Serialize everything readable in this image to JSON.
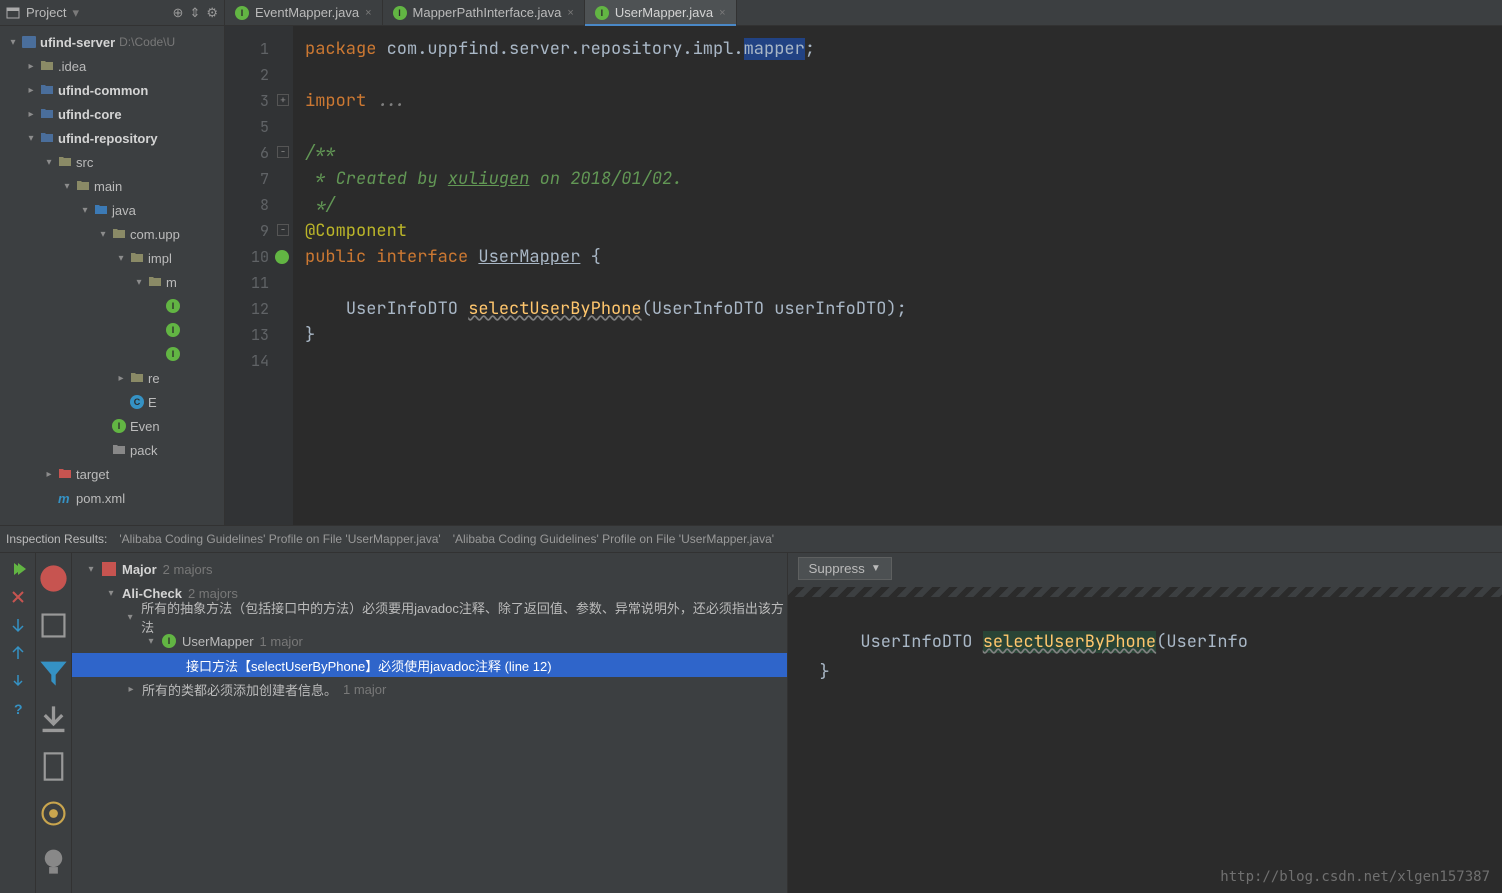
{
  "project": {
    "title": "Project",
    "root": "ufind-server",
    "root_path": "D:\\Code\\U",
    "tree": [
      {
        "label": ".idea",
        "depth": 1,
        "arrow": "closed",
        "icon": "folder"
      },
      {
        "label": "ufind-common",
        "depth": 1,
        "arrow": "closed",
        "icon": "module",
        "bold": true
      },
      {
        "label": "ufind-core",
        "depth": 1,
        "arrow": "closed",
        "icon": "module",
        "bold": true
      },
      {
        "label": "ufind-repository",
        "depth": 1,
        "arrow": "open",
        "icon": "module",
        "bold": true
      },
      {
        "label": "src",
        "depth": 2,
        "arrow": "open",
        "icon": "folder"
      },
      {
        "label": "main",
        "depth": 3,
        "arrow": "open",
        "icon": "folder"
      },
      {
        "label": "java",
        "depth": 4,
        "arrow": "open",
        "icon": "srcfolder"
      },
      {
        "label": "com.upp",
        "depth": 5,
        "arrow": "open",
        "icon": "package"
      },
      {
        "label": "impl",
        "depth": 6,
        "arrow": "open",
        "icon": "package"
      },
      {
        "label": "m",
        "depth": 7,
        "arrow": "open",
        "icon": "package"
      },
      {
        "label": "",
        "depth": 8,
        "arrow": "none",
        "icon": "class-i"
      },
      {
        "label": "",
        "depth": 8,
        "arrow": "none",
        "icon": "class-i"
      },
      {
        "label": "",
        "depth": 8,
        "arrow": "none",
        "icon": "class-i"
      },
      {
        "label": "re",
        "depth": 6,
        "arrow": "closed",
        "icon": "package"
      },
      {
        "label": "E",
        "depth": 6,
        "arrow": "none",
        "icon": "class-c"
      },
      {
        "label": "Even",
        "depth": 5,
        "arrow": "none",
        "icon": "class-i"
      },
      {
        "label": "pack",
        "depth": 5,
        "arrow": "none",
        "icon": "file"
      },
      {
        "label": "target",
        "depth": 2,
        "arrow": "closed",
        "icon": "target"
      },
      {
        "label": "pom.xml",
        "depth": 2,
        "arrow": "none",
        "icon": "maven"
      }
    ]
  },
  "tabs": [
    {
      "label": "EventMapper.java",
      "active": false
    },
    {
      "label": "MapperPathInterface.java",
      "active": false
    },
    {
      "label": "UserMapper.java",
      "active": true
    }
  ],
  "editor": {
    "lines": [
      "1",
      "2",
      "3",
      "5",
      "6",
      "7",
      "8",
      "9",
      "10",
      "11",
      "12",
      "13",
      "14"
    ],
    "code": {
      "l1_kw": "package",
      "l1_pkg": "com.uppfind.server.repository.impl.",
      "l1_hl": "mapper",
      "l3_kw": "import",
      "l3_rest": "...",
      "l6": "/**",
      "l7_a": " * Created by ",
      "l7_auth": "xuliugen",
      "l7_b": " on 2018/01/02.",
      "l8": " */",
      "l9": "@Component",
      "l10_kw": "public interface",
      "l10_name": "UserMapper",
      "l10_brace": " {",
      "l12_type": "UserInfoDTO",
      "l12_method": "selectUserByPhone",
      "l12_sig": "(UserInfoDTO userInfoDTO);",
      "l13": "}"
    }
  },
  "inspection": {
    "header": "Inspection Results:",
    "profile1": "'Alibaba Coding Guidelines' Profile on File 'UserMapper.java'",
    "profile2": "'Alibaba Coding Guidelines' Profile on File 'UserMapper.java'",
    "suppress": "Suppress",
    "tree": {
      "major": "Major",
      "major_count": "2 majors",
      "alicheck": "Ali-Check",
      "alicheck_count": "2 majors",
      "rule1": "所有的抽象方法（包括接口中的方法）必须要用javadoc注释、除了返回值、参数、异常说明外，还必须指出该方法",
      "file": "UserMapper",
      "file_count": "1 major",
      "issue": "接口方法【selectUserByPhone】必须使用javadoc注释 (line 12)",
      "rule2": "所有的类都必须添加创建者信息。",
      "rule2_count": "1 major"
    },
    "preview": {
      "type": "UserInfoDTO",
      "method": "selectUserByPhone",
      "rest": "(UserInfo",
      "brace": "}"
    }
  },
  "watermark": "http://blog.csdn.net/xlgen157387"
}
